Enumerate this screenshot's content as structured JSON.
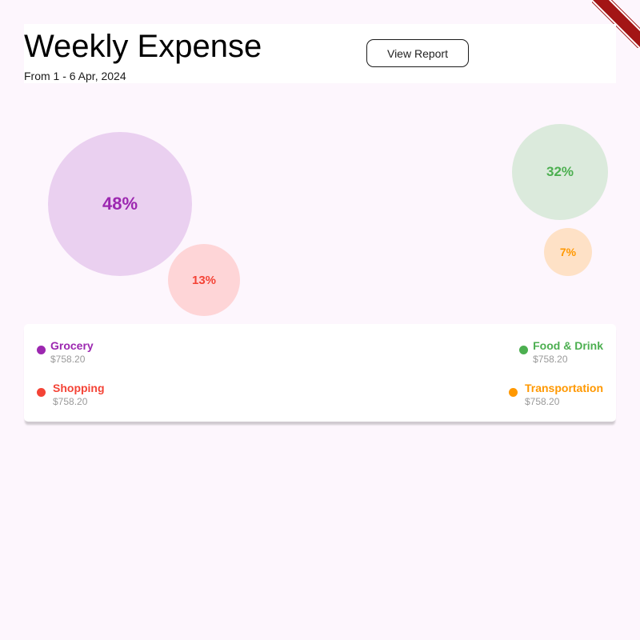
{
  "header": {
    "title": "Weekly Expense",
    "subtitle": "From 1 - 6 Apr, 2024",
    "report_button": "View Report"
  },
  "categories": [
    {
      "name": "Grocery",
      "amount": "$758.20",
      "percent": "48%",
      "color": "#9c27b0",
      "bubble_color": "#ead0f0"
    },
    {
      "name": "Food & Drink",
      "amount": "$758.20",
      "percent": "32%",
      "color": "#4caf50",
      "bubble_color": "#dbeadc"
    },
    {
      "name": "Shopping",
      "amount": "$758.20",
      "percent": "13%",
      "color": "#f44336",
      "bubble_color": "#fed5d7"
    },
    {
      "name": "Transportation",
      "amount": "$758.20",
      "percent": "7%",
      "color": "#ff9800",
      "bubble_color": "#fee1c6"
    }
  ]
}
